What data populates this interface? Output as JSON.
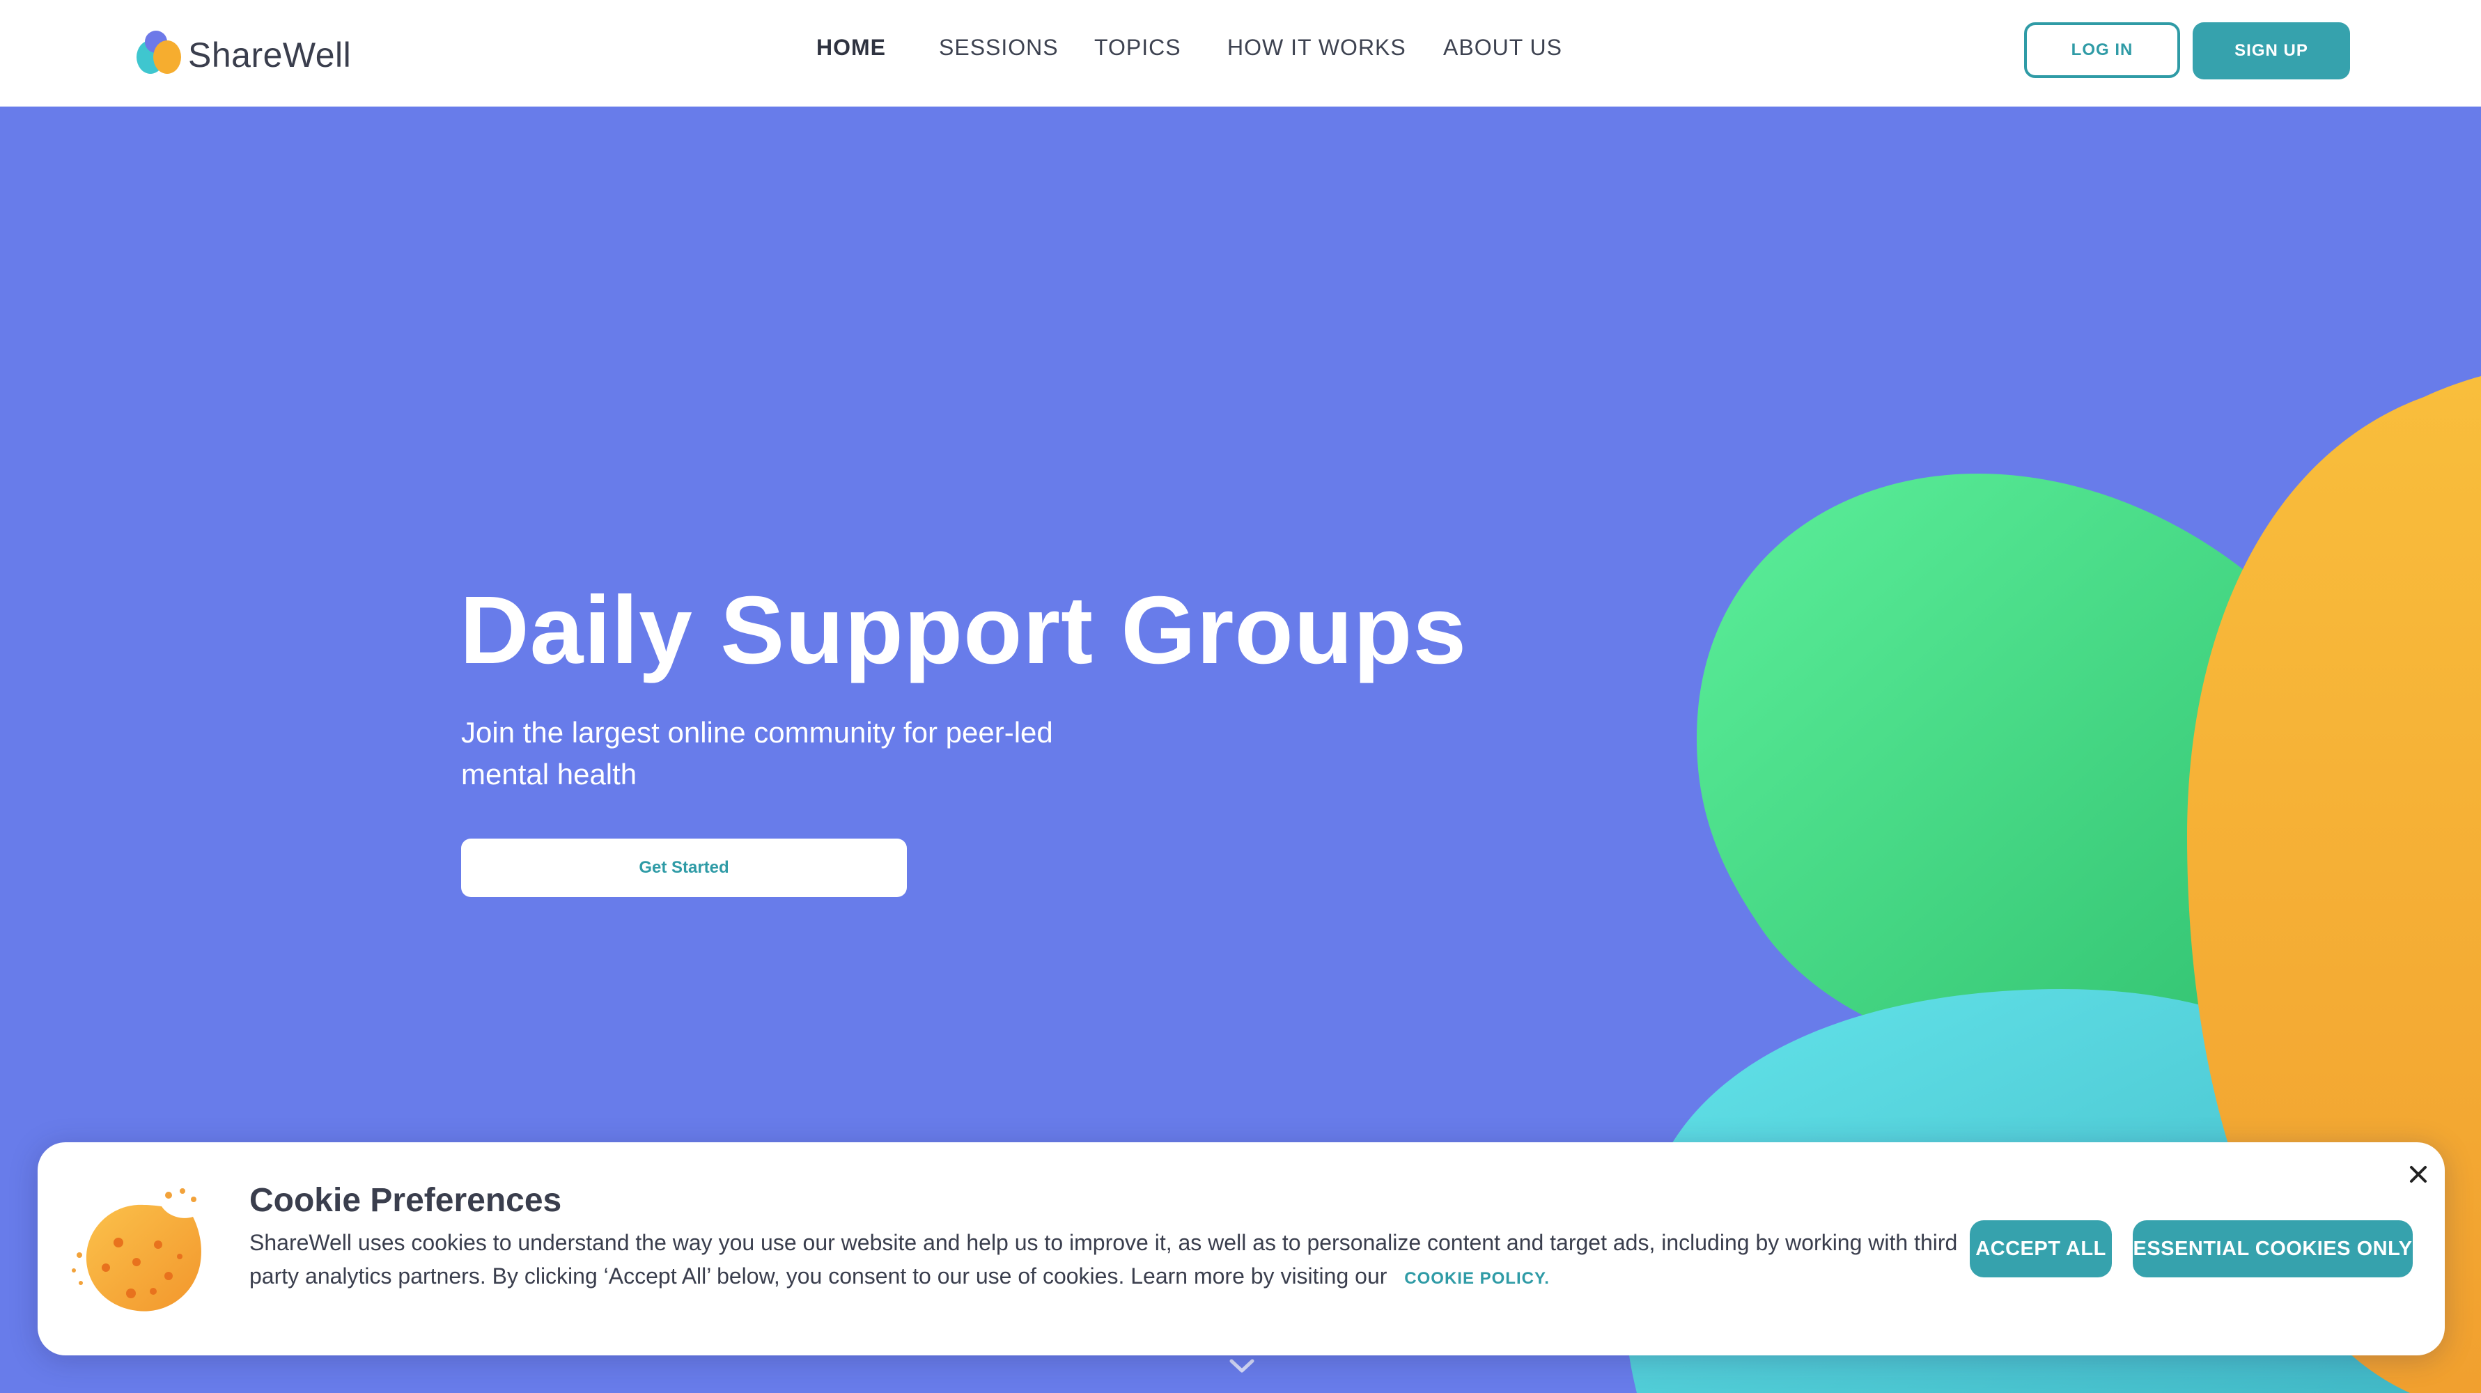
{
  "brand": {
    "name": "ShareWell"
  },
  "nav": {
    "items": [
      {
        "label": "HOME",
        "active": true
      },
      {
        "label": "SESSIONS",
        "active": false
      },
      {
        "label": "TOPICS",
        "active": false
      },
      {
        "label": "HOW IT WORKS",
        "active": false
      },
      {
        "label": "ABOUT US",
        "active": false
      }
    ],
    "login_label": "LOG IN",
    "signup_label": "SIGN UP"
  },
  "hero": {
    "title": "Daily Support Groups",
    "subtitle": "Join the largest online community for peer-led mental health",
    "cta_label": "Get Started"
  },
  "cookie_banner": {
    "title": "Cookie Preferences",
    "body": "ShareWell uses cookies to understand the way you use our website and help us to improve it, as well as to personalize content and target ads, including by working with third party analytics partners. By clicking ‘Accept All’ below, you consent to our use of cookies. Learn more by visiting our",
    "policy_link": "COOKIE POLICY.",
    "accept_label": "ACCEPT ALL",
    "essential_label": "ESSENTIAL COOKIES ONLY"
  },
  "icons": {
    "logo": "sharewell-logo-icon",
    "cookie": "cookie-icon",
    "close": "close-icon",
    "scroll": "chevron-down-icon"
  },
  "colors": {
    "hero_bg": "#687cea",
    "accent": "#36a2ad",
    "blob_green": "#4fdc8c",
    "blob_orange": "#f6b23a",
    "blob_cyan": "#56d4df"
  }
}
